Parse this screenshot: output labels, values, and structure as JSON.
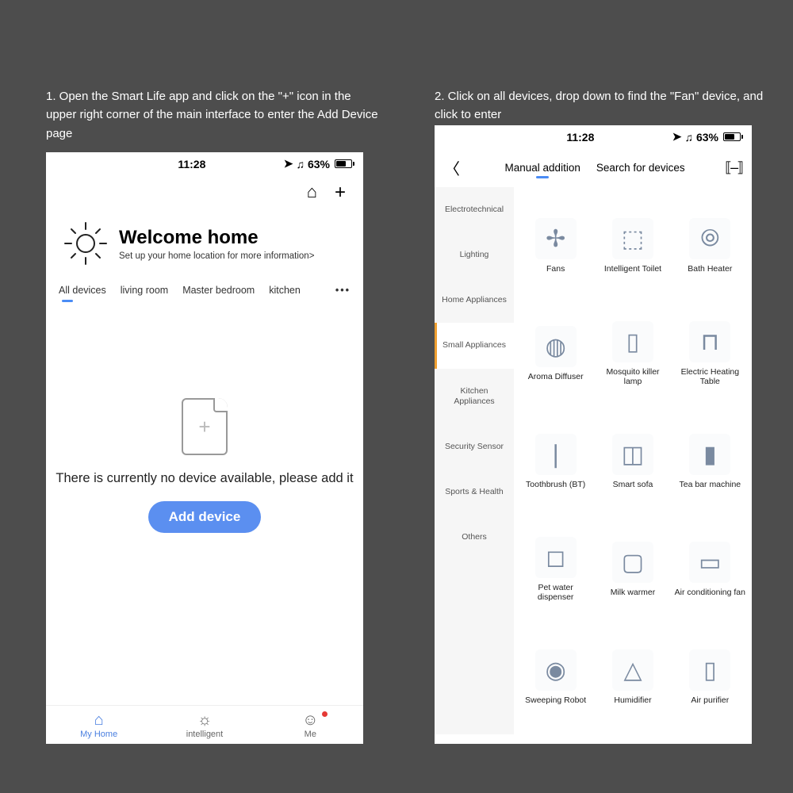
{
  "captions": {
    "c1": "1. Open the Smart Life app and click on the \"+\" icon in the upper right corner of the main interface to enter the Add Device page",
    "c2": "2. Click on all devices, drop down to find the \"Fan\" device, and click to enter"
  },
  "status": {
    "time": "11:28",
    "battery": "63%"
  },
  "phone1": {
    "welcome_title": "Welcome home",
    "welcome_sub": "Set up your home location for more information>",
    "rooms": [
      "All devices",
      "living room",
      "Master bedroom",
      "kitchen"
    ],
    "empty_line": "There is currently no device available, please add it",
    "add_button": "Add device",
    "tabs": [
      "My Home",
      "intelligent",
      "Me"
    ]
  },
  "phone2": {
    "top_tabs": [
      "Manual addition",
      "Search for devices"
    ],
    "categories": [
      "Electrotechnical",
      "Lighting",
      "Home Appliances",
      "Small Appliances",
      "Kitchen Appliances",
      "Security Sensor",
      "Sports & Health",
      "Others"
    ],
    "active_category_index": 3,
    "devices": [
      {
        "name": "Fans",
        "glyph": "✢"
      },
      {
        "name": "Intelligent Toilet",
        "glyph": "⬚"
      },
      {
        "name": "Bath Heater",
        "glyph": "⦾"
      },
      {
        "name": "Aroma Diffuser",
        "glyph": "◍"
      },
      {
        "name": "Mosquito killer lamp",
        "glyph": "▯"
      },
      {
        "name": "Electric Heating Table",
        "glyph": "⊓"
      },
      {
        "name": "Toothbrush (BT)",
        "glyph": "❘"
      },
      {
        "name": "Smart sofa",
        "glyph": "◫"
      },
      {
        "name": "Tea bar machine",
        "glyph": "▮"
      },
      {
        "name": "Pet water dispenser",
        "glyph": "◻"
      },
      {
        "name": "Milk warmer",
        "glyph": "▢"
      },
      {
        "name": "Air conditioning fan",
        "glyph": "▭"
      },
      {
        "name": "Sweeping Robot",
        "glyph": "◉"
      },
      {
        "name": "Humidifier",
        "glyph": "△"
      },
      {
        "name": "Air purifier",
        "glyph": "▯"
      }
    ]
  }
}
